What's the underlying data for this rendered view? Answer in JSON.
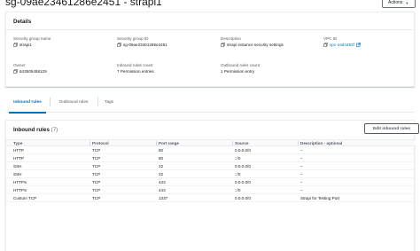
{
  "header": {
    "title": "sg-09ae23461286e2451 - strapi1",
    "actions_label": "Actions"
  },
  "details": {
    "heading": "Details",
    "fields": [
      {
        "label": "Security group name",
        "value": "strapi1"
      },
      {
        "label": "Security group ID",
        "value": "sg-09ae23461286e2451"
      },
      {
        "label": "Description",
        "value": "strapi instance security settings"
      },
      {
        "label": "VPC ID",
        "value": "vpc-44d4492f"
      },
      {
        "label": "Owner",
        "value": "643505458129"
      },
      {
        "label": "Inbound rules count",
        "value": "7 Permission entries"
      },
      {
        "label": "Outbound rules count",
        "value": "1 Permission entry"
      }
    ]
  },
  "tabs": [
    {
      "label": "Inbound rules",
      "active": true
    },
    {
      "label": "Outbound rules",
      "active": false
    },
    {
      "label": "Tags",
      "active": false
    }
  ],
  "inbound": {
    "title": "Inbound rules",
    "count": "(7)",
    "edit_label": "Edit inbound rules",
    "columns": [
      "Type",
      "Protocol",
      "Port range",
      "Source",
      "Description - optional"
    ],
    "rows": [
      [
        "HTTP",
        "TCP",
        "80",
        "0.0.0.0/0",
        "–"
      ],
      [
        "HTTP",
        "TCP",
        "80",
        "::/0",
        "–"
      ],
      [
        "SSH",
        "TCP",
        "22",
        "0.0.0.0/0",
        "–"
      ],
      [
        "SSH",
        "TCP",
        "22",
        "::/0",
        "–"
      ],
      [
        "HTTPS",
        "TCP",
        "443",
        "0.0.0.0/0",
        "–"
      ],
      [
        "HTTPS",
        "TCP",
        "443",
        "::/0",
        "–"
      ],
      [
        "Custom TCP",
        "TCP",
        "1337",
        "0.0.0.0/0",
        "Strapi for Testing Port"
      ]
    ]
  },
  "colors": {
    "link": "#0073bb",
    "text": "#16191f",
    "muted": "#545b64"
  }
}
